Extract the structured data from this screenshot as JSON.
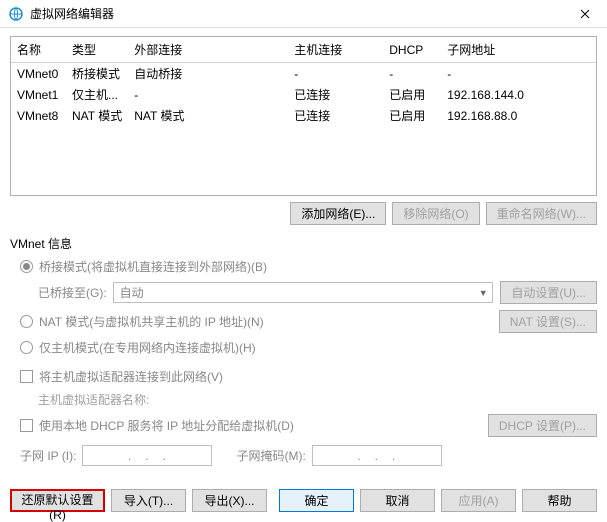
{
  "titlebar": {
    "title": "虚拟网络编辑器"
  },
  "grid": {
    "headers": [
      "名称",
      "类型",
      "外部连接",
      "主机连接",
      "DHCP",
      "子网地址"
    ],
    "rows": [
      {
        "name": "VMnet0",
        "type": "桥接模式",
        "ext": "自动桥接",
        "host": "-",
        "dhcp": "-",
        "subnet": "-"
      },
      {
        "name": "VMnet1",
        "type": "仅主机...",
        "ext": "-",
        "host": "已连接",
        "dhcp": "已启用",
        "subnet": "192.168.144.0"
      },
      {
        "name": "VMnet8",
        "type": "NAT 模式",
        "ext": "NAT 模式",
        "host": "已连接",
        "dhcp": "已启用",
        "subnet": "192.168.88.0"
      }
    ]
  },
  "buttons": {
    "add": "添加网络(E)...",
    "remove": "移除网络(O)",
    "rename": "重命名网络(W)...",
    "autoset": "自动设置(U)...",
    "natset": "NAT 设置(S)...",
    "dhcpset": "DHCP 设置(P)...",
    "restore": "还原默认设置(R)",
    "import": "导入(T)...",
    "export": "导出(X)...",
    "ok": "确定",
    "cancel": "取消",
    "apply": "应用(A)",
    "help": "帮助"
  },
  "info": {
    "section": "VMnet 信息",
    "bridge": "桥接模式(将虚拟机直接连接到外部网络)(B)",
    "bridgeto": "已桥接至(G):",
    "bridgeauto": "自动",
    "nat": "NAT 模式(与虚拟机共享主机的 IP 地址)(N)",
    "hostonly": "仅主机模式(在专用网络内连接虚拟机)(H)",
    "hostadapter": "将主机虚拟适配器连接到此网络(V)",
    "hostadaptername": "主机虚拟适配器名称:",
    "usedhcp": "使用本地 DHCP 服务将 IP 地址分配给虚拟机(D)",
    "subnetip": "子网 IP (I):",
    "subnetmask": "子网掩码(M):"
  }
}
